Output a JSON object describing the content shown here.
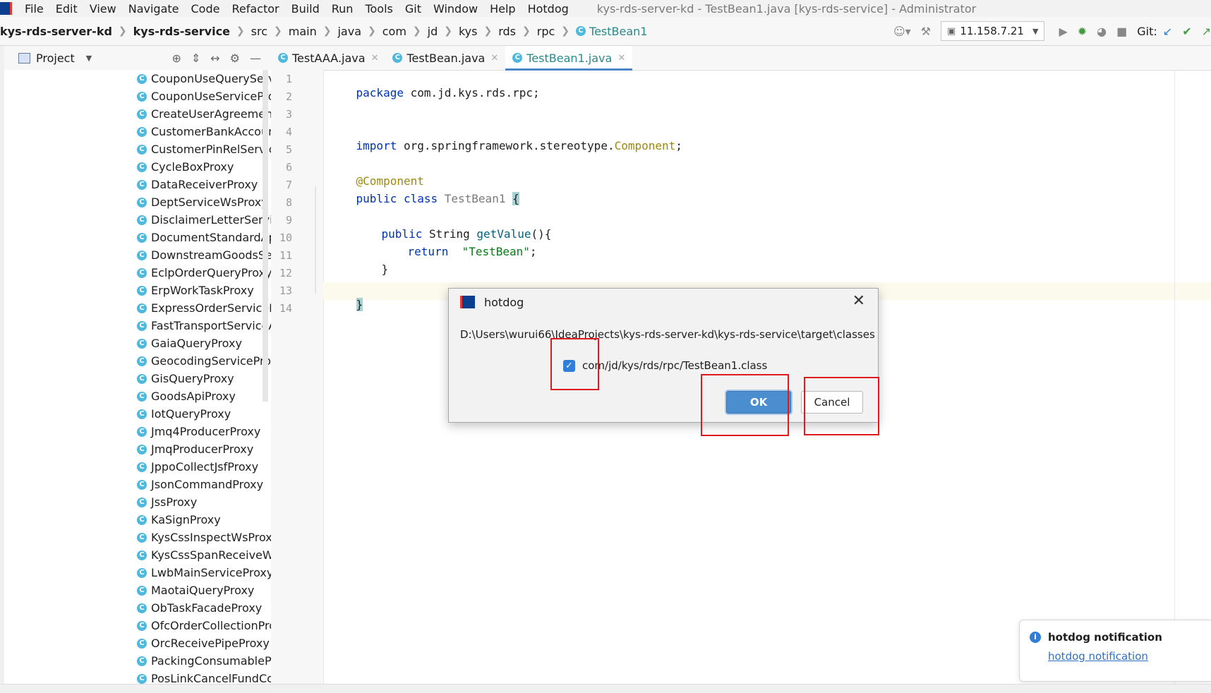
{
  "menubar": {
    "items": [
      "File",
      "Edit",
      "View",
      "Navigate",
      "Code",
      "Refactor",
      "Build",
      "Run",
      "Tools",
      "Git",
      "Window",
      "Help",
      "Hotdog"
    ],
    "title": "kys-rds-server-kd - TestBean1.java [kys-rds-service] - Administrator"
  },
  "breadcrumb": {
    "items": [
      "kys-rds-server-kd",
      "kys-rds-service",
      "src",
      "main",
      "java",
      "com",
      "jd",
      "kys",
      "rds",
      "rpc"
    ],
    "file": "TestBean1"
  },
  "toolbar": {
    "run_config": "11.158.7.21",
    "git_label": "Git:"
  },
  "project_panel": {
    "title": "Project",
    "items": [
      "CouponUseQueryServi",
      "CouponUseServiceProx",
      "CreateUserAgreement",
      "CustomerBankAccount",
      "CustomerPinRelService",
      "CycleBoxProxy",
      "DataReceiverProxy",
      "DeptServiceWsProxy",
      "DisclaimerLetterService",
      "DocumentStandardApi",
      "DownstreamGoodsServ",
      "EclpOrderQueryProxy",
      "ErpWorkTaskProxy",
      "ExpressOrderServicePr",
      "FastTransportServiceAp",
      "GaiaQueryProxy",
      "GeocodingServiceProx",
      "GisQueryProxy",
      "GoodsApiProxy",
      "IotQueryProxy",
      "Jmq4ProducerProxy",
      "JmqProducerProxy",
      "JppoCollectJsfProxy",
      "JsonCommandProxy",
      "JssProxy",
      "KaSignProxy",
      "KysCssInspectWsProxy",
      "KysCssSpanReceiveWh",
      "LwbMainServiceProxy",
      "MaotaiQueryProxy",
      "ObTaskFacadeProxy",
      "OfcOrderCollectionPro",
      "OrcReceivePipeProxy",
      "PackingConsumablePro",
      "PosLinkCancelFundColl"
    ]
  },
  "tabs": [
    {
      "label": "TestAAA.java"
    },
    {
      "label": "TestBean.java"
    },
    {
      "label": "TestBean1.java"
    }
  ],
  "editor": {
    "line_numbers": [
      "1",
      "2",
      "3",
      "4",
      "5",
      "6",
      "7",
      "8",
      "9",
      "10",
      "11",
      "12",
      "13",
      "14"
    ],
    "l1_kw": "package",
    "l1_rest": " com.jd.kys.rds.rpc;",
    "l4_kw": "import",
    "l4_pkg": " org.springframework.stereotype.",
    "l4_ann": "Component",
    "l4_end": ";",
    "l6_ann": "@Component",
    "l7_kw": "public class",
    "l7_cls": " TestBean1 ",
    "l7_brace": "{",
    "l9_kw": "public",
    "l9_type": " String ",
    "l9_fn": "getValue",
    "l9_end": "(){",
    "l10_kw": "return",
    "l10_str": "\"TestBean\"",
    "l10_end": ";",
    "l11": "}",
    "l13": "}"
  },
  "dialog": {
    "title": "hotdog",
    "path": "D:\\Users\\wurui66\\IdeaProjects\\kys-rds-server-kd\\kys-rds-service\\target\\classes",
    "checkbox_label": "com/jd/kys/rds/rpc/TestBean1.class",
    "checkbox_checked": true,
    "ok_label": "OK",
    "cancel_label": "Cancel"
  },
  "notification": {
    "title": "hotdog notification",
    "link": "hotdog notification"
  },
  "icons": {
    "class_icon": "C"
  }
}
